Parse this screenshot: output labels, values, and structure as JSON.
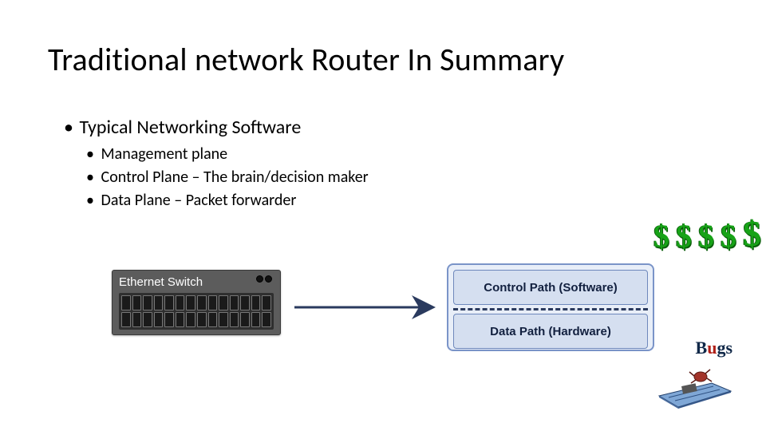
{
  "title": "Traditional network Router In Summary",
  "bullets": {
    "top": "Typical Networking Software",
    "subs": [
      "Management plane",
      "Control Plane – The brain/decision maker",
      "Data Plane – Packet forwarder"
    ]
  },
  "dollar_signs": {
    "count": 5,
    "glyph": "$"
  },
  "switch_label": "Ethernet Switch",
  "switch_ports": {
    "rows": 2,
    "cols": 14
  },
  "router_box": {
    "control": "Control Path (Software)",
    "data": "Data Path (Hardware)"
  },
  "bugs_label": "Bugs"
}
